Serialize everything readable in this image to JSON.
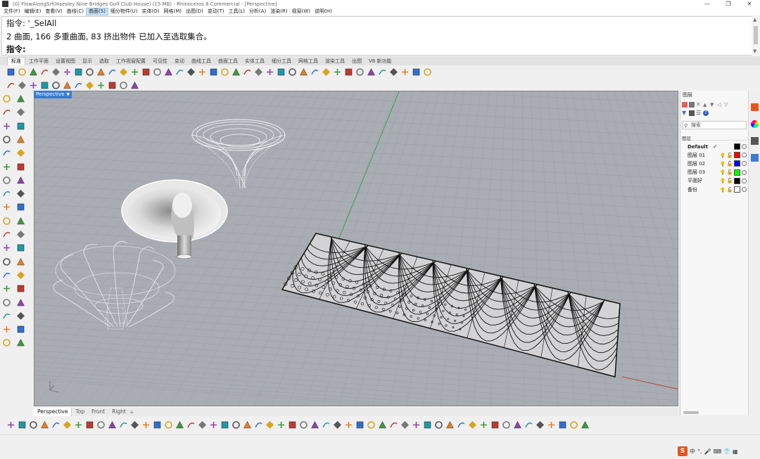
{
  "window": {
    "title": "(0) FlowAlongSrf(Haesley Nine Bridges Golf Club House) (15 MB) - Rhinoceros 8 Commercial - [Perspective]",
    "controls": [
      "—",
      "❐",
      "✕"
    ]
  },
  "menu": {
    "items": [
      "文件(F)",
      "编辑(E)",
      "查看(V)",
      "曲线(C)",
      "曲面(S)",
      "细分物件(U)",
      "实体(O)",
      "网格(M)",
      "出图(D)",
      "变动(T)",
      "工具(L)",
      "分析(A)",
      "渲染(R)",
      "视窗(W)",
      "说明(H)"
    ],
    "active_index": 4
  },
  "command": {
    "history_line1": "指令: '_SelAll",
    "history_line2": "2 曲面, 166 多重曲面, 83 挤出物件 已加入至选取集合。",
    "prompt": "指令:"
  },
  "tabs": {
    "items": [
      "标准",
      "工作平面",
      "设置视图",
      "显示",
      "选取",
      "工作视窗配置",
      "可见性",
      "变动",
      "曲线工具",
      "曲面工具",
      "实体工具",
      "细分工具",
      "网格工具",
      "渲染工具",
      "出图",
      "V8 新功能"
    ],
    "active_index": 0
  },
  "viewport": {
    "label": "Perspective",
    "background": "#a9adb3",
    "grid_color": "#9ba0a6",
    "axis_x_color": "#c0392b",
    "axis_y_color": "#27ae60"
  },
  "view_tabs": {
    "items": [
      "Perspective",
      "Top",
      "Front",
      "Right"
    ],
    "active_index": 0,
    "add_label": "+"
  },
  "layers_panel": {
    "title": "图层",
    "search_placeholder": "搜索",
    "header": "图层",
    "layers": [
      {
        "name": "Default",
        "current": true,
        "color": "#000000"
      },
      {
        "name": "图层 01",
        "current": false,
        "color": "#ff0000"
      },
      {
        "name": "图层 02",
        "current": false,
        "color": "#0000ff"
      },
      {
        "name": "图层 03",
        "current": false,
        "color": "#00ff00"
      },
      {
        "name": "平面好",
        "current": false,
        "color": "#000000"
      },
      {
        "name": "备份",
        "current": false,
        "color": "#ffffff"
      }
    ]
  },
  "ime": {
    "logo": "S",
    "items": [
      "中",
      "°,",
      "🎤",
      "⌨",
      "👕",
      "▦"
    ]
  }
}
